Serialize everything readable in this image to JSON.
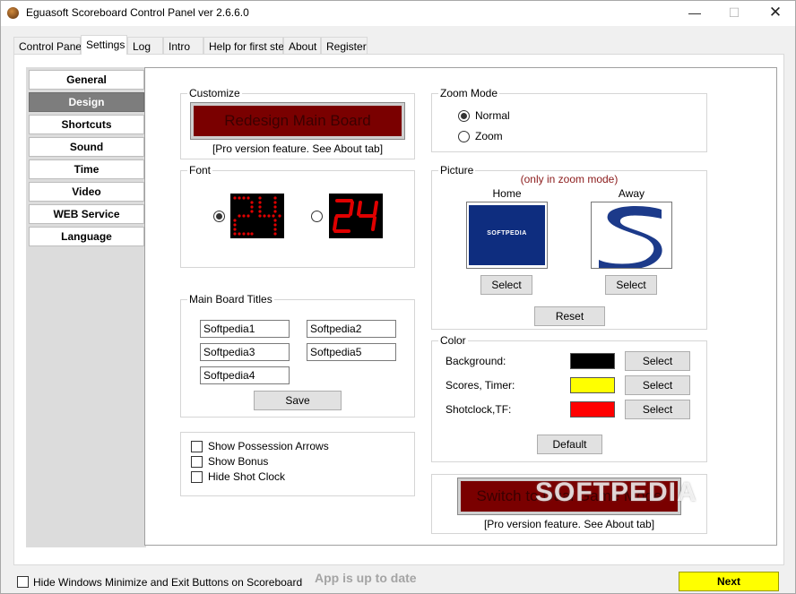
{
  "window": {
    "title": "Eguasoft Scoreboard Control Panel ver 2.6.6.0"
  },
  "tabs": [
    "Control Panel",
    "Settings",
    "Log",
    "Intro",
    "Help for first step",
    "About",
    "Register"
  ],
  "sidebar": {
    "items": [
      {
        "label": "General"
      },
      {
        "label": "Design"
      },
      {
        "label": "Shortcuts"
      },
      {
        "label": "Sound"
      },
      {
        "label": "Time"
      },
      {
        "label": "Video"
      },
      {
        "label": "WEB Service"
      },
      {
        "label": "Language"
      }
    ],
    "active": "Design"
  },
  "customize": {
    "title": "Customize",
    "button": "Redesign Main Board",
    "note": "[Pro version feature. See About tab]"
  },
  "font": {
    "title": "Font",
    "sample_dot": "24",
    "sample_seg": "24",
    "selected": "dot"
  },
  "titles": {
    "title": "Main Board Titles",
    "fields": [
      "Softpedia1",
      "Softpedia2",
      "Softpedia3",
      "Softpedia5",
      "Softpedia4"
    ],
    "save": "Save"
  },
  "options": {
    "possession": "Show Possession Arrows",
    "bonus": "Show Bonus",
    "hide_shot_clock": "Hide Shot Clock"
  },
  "zoom": {
    "title": "Zoom Mode",
    "normal": "Normal",
    "zoom": "Zoom",
    "selected": "Normal"
  },
  "picture": {
    "title": "Picture",
    "note": "(only in zoom mode)",
    "home": "Home",
    "away": "Away",
    "home_logo_text": "SOFTPEDIA",
    "select": "Select",
    "reset": "Reset"
  },
  "color": {
    "title": "Color",
    "rows": [
      {
        "label": "Background:",
        "color": "#000000",
        "button": "Select"
      },
      {
        "label": "Scores, Timer:",
        "color": "#ffff00",
        "button": "Select"
      },
      {
        "label": "Shotclock,TF:",
        "color": "#ff0000",
        "button": "Select"
      }
    ],
    "default": "Default"
  },
  "dual": {
    "button": "Switch to Dual Game Mode",
    "note": "[Pro version feature. See About tab]",
    "watermark": "SOFTPEDIA"
  },
  "footer": {
    "hide_buttons": "Hide Windows Minimize and Exit Buttons on Scoreboard",
    "status": "App is up to date",
    "next": "Next"
  },
  "colors": {
    "accent_red": "#7a0000",
    "active_sidebar": "#7d7d7d",
    "next_button": "#ffff00",
    "digit_red": "#e00000"
  },
  "icons": {
    "app": "basketball-icon",
    "minimize": "minimize-icon",
    "maximize": "maximize-icon",
    "close": "close-icon"
  }
}
